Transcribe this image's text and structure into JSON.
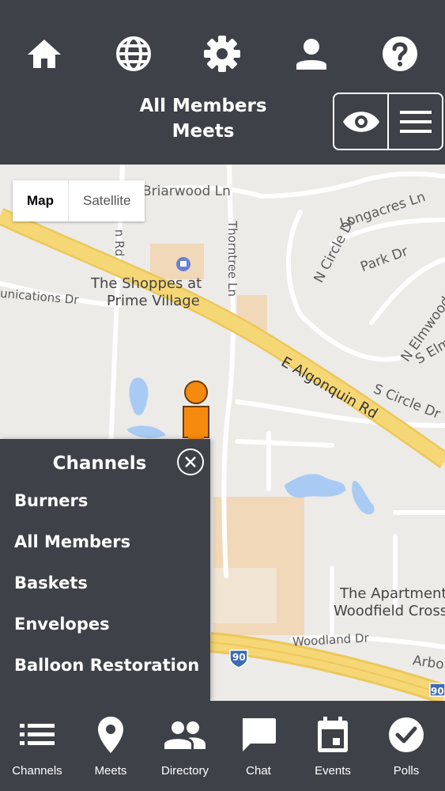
{
  "header": {
    "title_line1": "All Members",
    "title_line2": "Meets",
    "nav_icons": [
      "home-icon",
      "globe-icon",
      "gear-icon",
      "person-icon",
      "help-icon"
    ],
    "view_buttons": [
      "eye-icon",
      "hamburger-menu-icon"
    ]
  },
  "map": {
    "type_active": "Map",
    "type_inactive": "Satellite",
    "labels": {
      "briarwood": "Briarwood Ln",
      "longacres": "Longacres Ln",
      "ncircle": "N Circle Dr",
      "park": "Park Dr",
      "elmwood": "N Elmwood Dr",
      "selm": "S Elm",
      "shoppes1": "The Shoppes at",
      "shoppes2": "Prime Village",
      "unications": "unications Dr",
      "ealgonquin": "E Algonquin Rd",
      "scircle": "S Circle Dr",
      "apartments1": "The Apartment",
      "apartments2": "Woodfield Cross",
      "woodland": "Woodland Dr",
      "arbo": "Arbo",
      "thorntree": "Thorntree Ln",
      "rd": "n Rd",
      "i90": "90",
      "i90b": "90"
    }
  },
  "channels": {
    "title": "Channels",
    "items": [
      "Burners",
      "All Members",
      "Baskets",
      "Envelopes",
      "Balloon Restoration"
    ]
  },
  "tabs": [
    {
      "label": "Channels",
      "icon": "list-icon"
    },
    {
      "label": "Meets",
      "icon": "map-pin-icon"
    },
    {
      "label": "Directory",
      "icon": "people-icon"
    },
    {
      "label": "Chat",
      "icon": "chat-bubble-icon"
    },
    {
      "label": "Events",
      "icon": "calendar-icon"
    },
    {
      "label": "Polls",
      "icon": "check-circle-icon"
    }
  ],
  "colors": {
    "bar": "#3e4148",
    "road_major": "#f6d776",
    "water": "#a9cbf3",
    "building": "#f0d8b8",
    "pegman": "#f68a0e"
  }
}
